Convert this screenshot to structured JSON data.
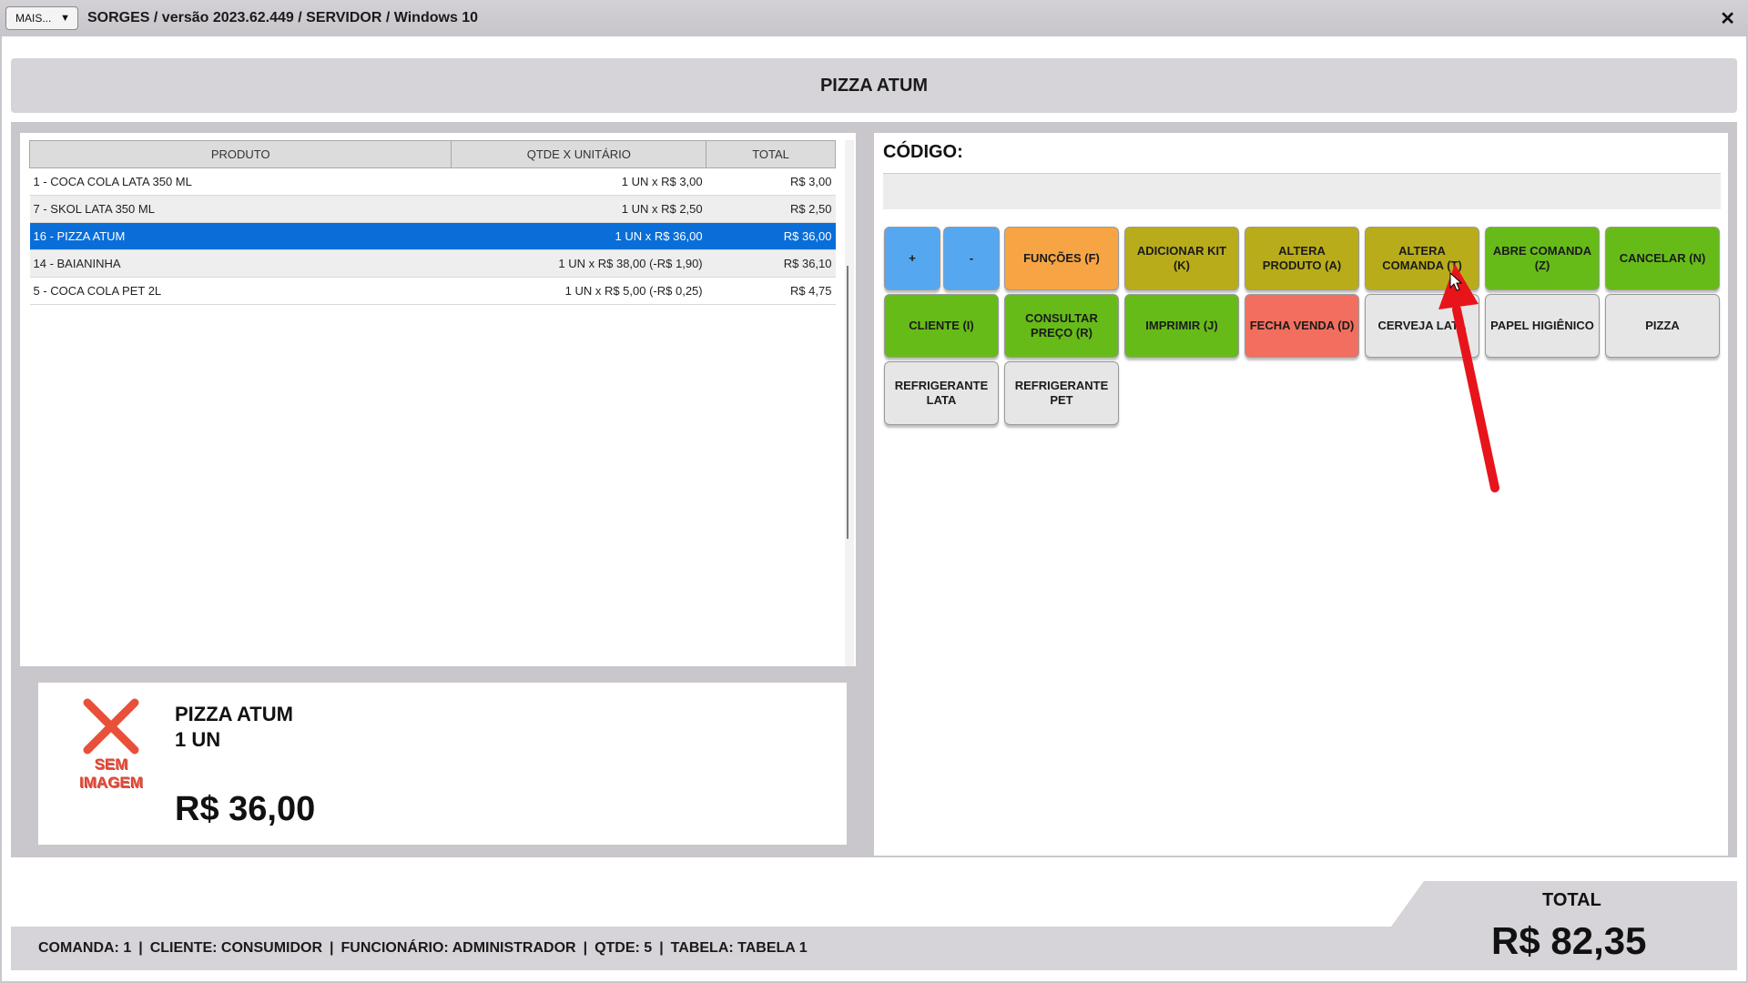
{
  "titlebar": {
    "mais_label": "MAIS...",
    "title": "SORGES / versão 2023.62.449 / SERVIDOR / Windows 10",
    "close": "✕"
  },
  "header": {
    "product": "PIZZA ATUM"
  },
  "table": {
    "columns": [
      "PRODUTO",
      "QTDE X UNITÁRIO",
      "TOTAL"
    ],
    "rows": [
      {
        "produto": "1 - COCA COLA LATA 350 ML",
        "qtde": "1 UN x R$ 3,00",
        "total": "R$ 3,00"
      },
      {
        "produto": "7 - SKOL LATA 350 ML",
        "qtde": "1 UN x R$ 2,50",
        "total": "R$ 2,50"
      },
      {
        "produto": "16 - PIZZA ATUM",
        "qtde": "1 UN x R$ 36,00",
        "total": "R$ 36,00"
      },
      {
        "produto": "14 - BAIANINHA",
        "qtde": "1 UN x R$ 38,00 (-R$ 1,90)",
        "total": "R$ 36,10"
      },
      {
        "produto": "5 - COCA COLA PET 2L",
        "qtde": "1 UN x R$ 5,00 (-R$ 0,25)",
        "total": "R$ 4,75"
      }
    ],
    "selected_index": 2
  },
  "info": {
    "no_image_line1": "SEM",
    "no_image_line2": "IMAGEM",
    "name": "PIZZA ATUM",
    "qty": "1  UN",
    "price": "R$ 36,00"
  },
  "codigo": {
    "label": "CÓDIGO:",
    "value": ""
  },
  "buttons": {
    "plus": "+",
    "minus": "-",
    "funcoes": "FUNÇÕES (F)",
    "adicionar_kit": "ADICIONAR KIT (K)",
    "altera_produto": "ALTERA PRODUTO (A)",
    "altera_comanda": "ALTERA COMANDA (T)",
    "abre_comanda": "ABRE COMANDA (Z)",
    "cancelar": "CANCELAR (N)",
    "cliente": "CLIENTE (I)",
    "consultar_preco": "CONSULTAR PREÇO (R)",
    "imprimir": "IMPRIMIR (J)",
    "fecha_venda": "FECHA VENDA (D)",
    "cerveja_lata": "CERVEJA LATA",
    "papel_higienico": "PAPEL HIGIÊNICO",
    "pizza": "PIZZA",
    "refrigerante_lata": "REFRIGERANTE LATA",
    "refrigerante_pet": "REFRIGERANTE PET"
  },
  "status": {
    "comanda": "COMANDA: 1",
    "cliente": "CLIENTE: CONSUMIDOR",
    "funcionario": "FUNCIONÁRIO: ADMINISTRADOR",
    "qtde": "QTDE: 5",
    "tabela": "TABELA: TABELA 1",
    "separator": "|"
  },
  "total": {
    "label": "TOTAL",
    "value": "R$ 82,35"
  },
  "colors": {
    "selected_row": "#0a6ed8",
    "blue_btn": "#55a8f0",
    "orange_btn": "#f7a544",
    "olive_btn": "#b9ac1a",
    "green_btn": "#67bb18",
    "red_btn": "#f26f5f",
    "annotation_arrow": "#e8141b"
  }
}
